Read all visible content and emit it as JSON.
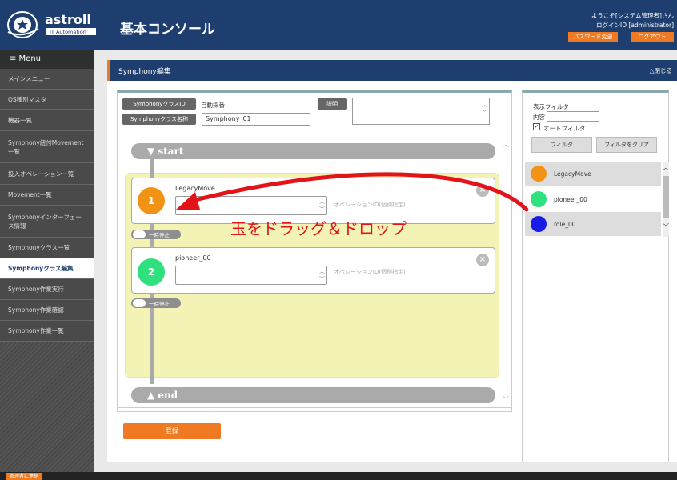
{
  "header": {
    "brand": "astroll",
    "brand_tag": "IT Automation",
    "title": "基本コンソール",
    "welcome": "ようこそ[システム管理者]さん",
    "login_id": "ログインID [administrator]",
    "password_change": "パスワード変更",
    "logout": "ログアウト"
  },
  "sidebar": {
    "menu_label": "≡ Menu",
    "items": [
      {
        "label": "メインメニュー",
        "active": false
      },
      {
        "label": "OS種別マスタ",
        "active": false
      },
      {
        "label": "機器一覧",
        "active": false
      },
      {
        "label": "Symphony紐付Movement一覧",
        "active": false
      },
      {
        "label": "投入オペレーション一覧",
        "active": false
      },
      {
        "label": "Movement一覧",
        "active": false
      },
      {
        "label": "Symphonyインターフェース情報",
        "active": false
      },
      {
        "label": "Symphonyクラス一覧",
        "active": false
      },
      {
        "label": "Symphonyクラス編集",
        "active": true
      },
      {
        "label": "Symphony作業実行",
        "active": false
      },
      {
        "label": "Symphony作業確認",
        "active": false
      },
      {
        "label": "Symphony作業一覧",
        "active": false
      }
    ]
  },
  "footer": {
    "contact": "管理者に連絡"
  },
  "main": {
    "title": "Symphony編集",
    "close_label": "△閉じる",
    "class_id_label": "SymphonyクラスID",
    "class_id_value": "自動採番",
    "description_label": "説明",
    "class_name_label": "Symphonyクラス名称",
    "class_name_value": "Symphony_01",
    "start_label": "▼ start",
    "end_label": "▲ end",
    "movements": [
      {
        "number": "1",
        "name": "LegacyMove",
        "color": "#f39315",
        "operation_placeholder": "オペレーションID(個別指定)"
      },
      {
        "number": "2",
        "name": "pioneer_00",
        "color": "#2ee07e",
        "operation_placeholder": "オペレーションID(個別指定)"
      }
    ],
    "pause_label": "一時停止",
    "register_button": "登録",
    "annotation": "玉をドラッグ＆ドロップ"
  },
  "filter": {
    "title": "表示フィルタ",
    "content_label": "内容",
    "content_value": "",
    "auto_filter_label": "オートフィルタ",
    "auto_filter_checked": true,
    "filter_button": "フィルタ",
    "clear_button": "フィルタをクリア"
  },
  "movement_list": [
    {
      "name": "LegacyMove",
      "color": "#f39315"
    },
    {
      "name": "pioneer_00",
      "color": "#2ee07e"
    },
    {
      "name": "role_00",
      "color": "#1a1ae6"
    }
  ],
  "colors": {
    "header": "#1d3e6e",
    "accent": "#ef7a21",
    "drop_zone": "#f4f3b6",
    "annotation": "#e2141a"
  }
}
